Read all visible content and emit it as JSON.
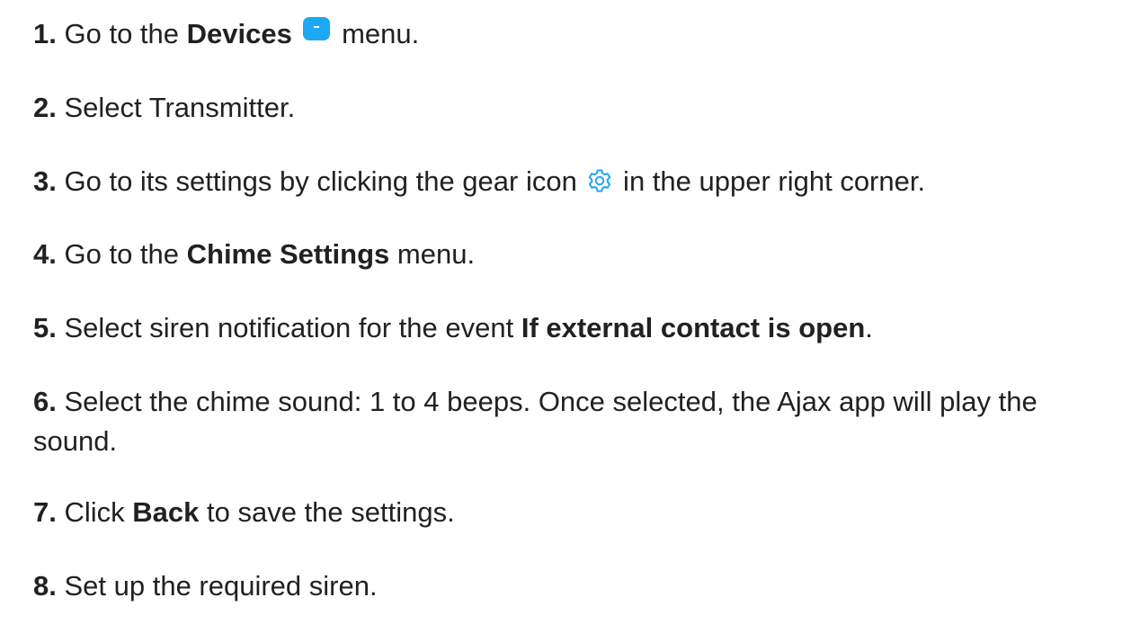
{
  "steps": [
    {
      "num": "1.",
      "pre": "Go to the ",
      "bold": "Devices",
      "post": " menu.",
      "icon": "devices-icon"
    },
    {
      "num": "2.",
      "text": "Select Transmitter."
    },
    {
      "num": "3.",
      "pre": "Go to its settings by clicking the gear icon ",
      "post": " in the upper right corner.",
      "icon": "gear-icon"
    },
    {
      "num": "4.",
      "pre": "Go to the ",
      "bold": "Chime Settings",
      "post": " menu."
    },
    {
      "num": "5.",
      "pre": "Select siren notification for the event ",
      "bold": "If external contact is open",
      "post": "."
    },
    {
      "num": "6.",
      "text": "Select the chime sound: 1 to 4 beeps. Once selected, the Ajax app will play the sound."
    },
    {
      "num": "7.",
      "pre": "Click ",
      "bold": "Back",
      "post": " to save the settings."
    },
    {
      "num": "8.",
      "text": "Set up the required siren."
    }
  ],
  "colors": {
    "text": "#212121",
    "accent": "#1ea7f2"
  }
}
